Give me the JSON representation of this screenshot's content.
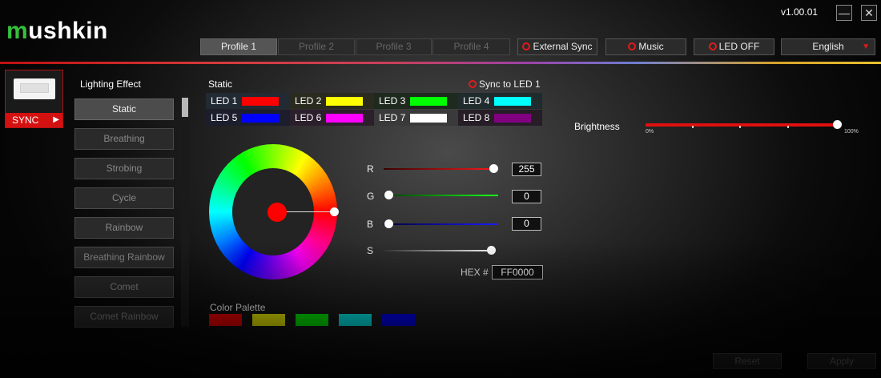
{
  "app": {
    "logo": "mushkin",
    "logo_first": "m",
    "logo_rest": "ushkin",
    "version": "v1.00.01",
    "minimize": "—",
    "close": "✕"
  },
  "header": {
    "profiles": [
      "Profile 1",
      "Profile 2",
      "Profile 3",
      "Profile 4"
    ],
    "active_profile": "Profile 1",
    "external_sync": "External Sync",
    "music": "Music",
    "led_off": "LED OFF",
    "language": "English"
  },
  "device": {
    "sync_label": "SYNC"
  },
  "effects": {
    "title": "Lighting Effect",
    "items": [
      "Static",
      "Breathing",
      "Strobing",
      "Cycle",
      "Rainbow",
      "Breathing Rainbow",
      "Comet",
      "Comet Rainbow"
    ],
    "selected": "Static"
  },
  "static": {
    "title": "Static",
    "sync_to_led": "Sync to LED 1",
    "leds": [
      {
        "label": "LED 1",
        "color": "#ff0000"
      },
      {
        "label": "LED 2",
        "color": "#ffff00"
      },
      {
        "label": "LED 3",
        "color": "#00ff00"
      },
      {
        "label": "LED 4",
        "color": "#00ffff"
      },
      {
        "label": "LED 5",
        "color": "#0000ff"
      },
      {
        "label": "LED 6",
        "color": "#ff00ff"
      },
      {
        "label": "LED 7",
        "color": "#ffffff"
      },
      {
        "label": "LED 8",
        "color": "#800080"
      }
    ]
  },
  "color": {
    "r_label": "R",
    "r": "255",
    "g_label": "G",
    "g": "0",
    "b_label": "B",
    "b": "0",
    "s_label": "S",
    "hex_label": "HEX #",
    "hex": "FF0000",
    "current": "#ff0000"
  },
  "palette": {
    "title": "Color Palette",
    "colors": [
      "#ff0000",
      "#ffff00",
      "#00ff00",
      "#00ffff",
      "#0000ff"
    ]
  },
  "brightness": {
    "title": "Brightness",
    "min": "0%",
    "max": "100%",
    "value": 1.0
  },
  "footer": {
    "reset": "Reset",
    "apply": "Apply"
  }
}
